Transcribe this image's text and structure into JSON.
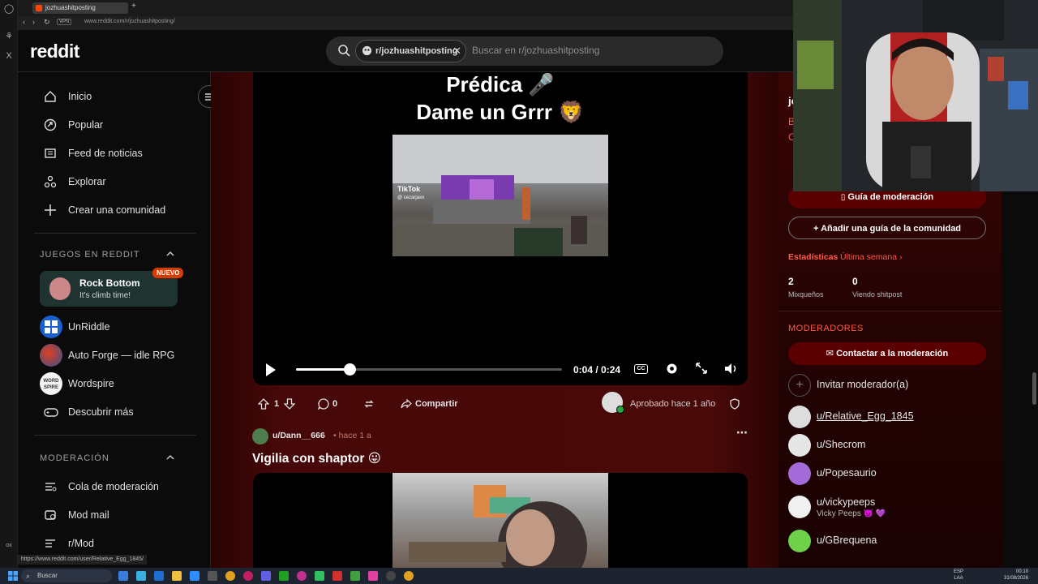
{
  "browser": {
    "tab_title": "jozhuashitposting",
    "url": "www.reddit.com/r/jozhuashitposting/",
    "vpn_label": "VPN",
    "status_url": "https://www.reddit.com/user/Relative_Egg_1845/"
  },
  "header": {
    "logo": "reddit",
    "search_chip": "r/jozhuashitposting",
    "search_placeholder": "Buscar en r/jozhuashitposting"
  },
  "sidebar": {
    "nav": [
      {
        "label": "Inicio",
        "icon": "home-icon"
      },
      {
        "label": "Popular",
        "icon": "popular-icon"
      },
      {
        "label": "Feed de noticias",
        "icon": "news-icon"
      },
      {
        "label": "Explorar",
        "icon": "explore-icon"
      },
      {
        "label": "Crear una comunidad",
        "icon": "plus-icon"
      }
    ],
    "games_heading": "JUEGOS EN REDDIT",
    "featured_game": {
      "title": "Rock Bottom",
      "subtitle": "It's climb time!",
      "badge": "NUEVO"
    },
    "games": [
      {
        "label": "UnRiddle"
      },
      {
        "label": "Auto Forge — idle RPG"
      },
      {
        "label": "Wordspire"
      },
      {
        "label": "Descubrir más"
      }
    ],
    "wordspire_logo": "WORD SPIRE",
    "mod_heading": "MODERACIÓN",
    "mod_items": [
      {
        "label": "Cola de moderación"
      },
      {
        "label": "Mod mail"
      },
      {
        "label": "r/Mod"
      }
    ]
  },
  "post1": {
    "title_line1": "Prédica 🎤",
    "title_line2": "Dame un Grrr 🦁",
    "watermark": "TikTok",
    "watermark_user": "@ cezarjaxx",
    "timecode": "0:04 / 0:24",
    "progress": 0.2,
    "votes": "1",
    "comments": "0",
    "share_label": "Compartir",
    "approved_label": "Aprobado hace 1 año"
  },
  "post2": {
    "user": "u/Dann__666",
    "time": "• hace 1 a",
    "title": "Vigilia con shaptor 😛"
  },
  "rightpanel": {
    "partial_letters": [
      "jo",
      "B",
      "C"
    ],
    "mod_guide_btn": "Guía de moderación",
    "community_guide_btn": "Añadir una guía de la comunidad",
    "stats_label": "Estadísticas",
    "stats_period": "Última semana",
    "stats": [
      {
        "value": "2",
        "label": "Mixqueños"
      },
      {
        "value": "0",
        "label": "Viendo shitpost"
      }
    ],
    "moderators_heading": "MODERADORES",
    "contact_btn": "Contactar a la moderación",
    "invite_label": "Invitar moderador(a)",
    "moderators": [
      {
        "name": "u/Relative_Egg_1845",
        "sub": ""
      },
      {
        "name": "u/Shecrom",
        "sub": ""
      },
      {
        "name": "u/Popesaurio",
        "sub": ""
      },
      {
        "name": "u/vickypeeps",
        "sub": "Vicky Peeps 👿 💜"
      },
      {
        "name": "u/GBrequena",
        "sub": ""
      }
    ]
  },
  "taskbar": {
    "search_label": "Buscar",
    "lang": "ESP",
    "lang2": "LAA",
    "time": "00:10",
    "date": "31/08/2026"
  },
  "colors": {
    "accent": "#ff4500",
    "mod_button": "#5a0000",
    "stats_label": "#ff5a4a",
    "nuevo_badge": "#d93a00"
  }
}
